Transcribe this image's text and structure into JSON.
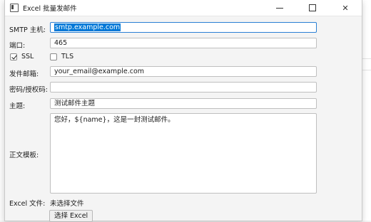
{
  "window": {
    "title": "Excel 批量发邮件"
  },
  "form": {
    "smtp_host": {
      "label": "SMTP 主机:",
      "value": "smtp.example.com"
    },
    "port": {
      "label": "端口:",
      "value": "465"
    },
    "ssl": {
      "label": "SSL",
      "checked": true
    },
    "tls": {
      "label": "TLS",
      "checked": false
    },
    "sender": {
      "label": "发件邮箱:",
      "value": "your_email@example.com"
    },
    "password": {
      "label": "密码/授权码:",
      "value": ""
    },
    "subject": {
      "label": "主题:",
      "value": "测试邮件主题"
    },
    "body": {
      "label": "正文模板:",
      "value": "您好，${name}，这是一封测试邮件。"
    },
    "excel": {
      "label": "Excel 文件:",
      "value": "未选择文件"
    },
    "choose_button": "选择 Excel"
  },
  "colors": {
    "focus_border": "#2a7fd4",
    "selection": "#0078d7"
  }
}
